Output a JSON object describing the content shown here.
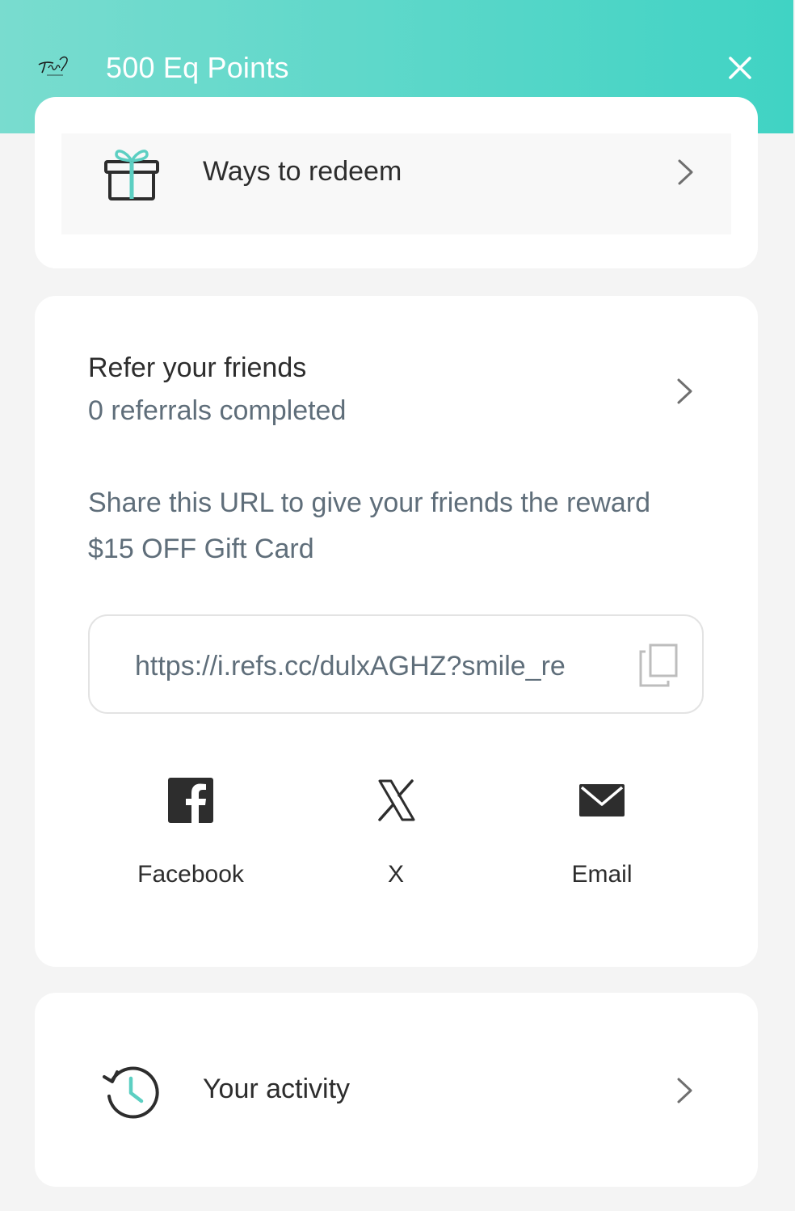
{
  "header": {
    "logo_text": "Trieu",
    "title": "500 Eq Points"
  },
  "redeem": {
    "label": "Ways to redeem"
  },
  "referral": {
    "title": "Refer your friends",
    "count_text": "0 referrals completed",
    "share_text": "Share this URL to give your friends the reward $15 OFF Gift Card",
    "url": "https://i.refs.cc/dulxAGHZ?smile_re",
    "share_buttons": [
      {
        "label": "Facebook",
        "icon": "facebook-icon"
      },
      {
        "label": "X",
        "icon": "x-icon"
      },
      {
        "label": "Email",
        "icon": "email-icon"
      }
    ]
  },
  "activity": {
    "label": "Your activity"
  },
  "colors": {
    "header_gradient_start": "#79dccf",
    "header_gradient_end": "#40d3c4",
    "accent_teal": "#5ccfc2",
    "muted_text": "#5f6e7a"
  }
}
